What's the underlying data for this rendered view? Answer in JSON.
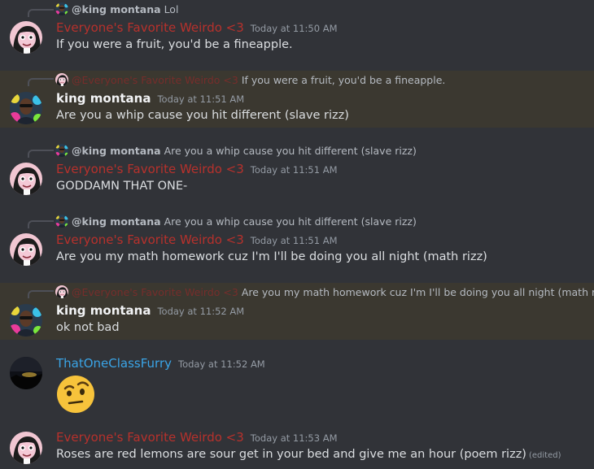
{
  "messages": [
    {
      "reply": {
        "author": "@king montana",
        "text": "Lol"
      },
      "author": "Everyone's Favorite Weirdo <3",
      "time": "Today at 11:50 AM",
      "content": "If you were a fruit, you'd be a fineapple."
    },
    {
      "reply": {
        "author": "@Everyone's Favorite Weirdo <3",
        "text": "If you were a fruit, you'd be a fineapple."
      },
      "author": "king montana",
      "time": "Today at 11:51 AM",
      "content": "Are you a whip cause you hit different (slave rizz)"
    },
    {
      "reply": {
        "author": "@king montana",
        "text": "Are you a whip cause you hit different (slave rizz)"
      },
      "author": "Everyone's Favorite Weirdo <3",
      "time": "Today at 11:51 AM",
      "content": "GODDAMN THAT ONE-"
    },
    {
      "reply": {
        "author": "@king montana",
        "text": "Are you a whip cause you hit different (slave rizz)"
      },
      "author": "Everyone's Favorite Weirdo <3",
      "time": "Today at 11:51 AM",
      "content": "Are you my math homework cuz I'm I'll be doing you all night (math rizz)"
    },
    {
      "reply": {
        "author": "@Everyone's Favorite Weirdo <3",
        "text": "Are you my math homework cuz I'm I'll be doing you all night (math rizz)"
      },
      "author": "king montana",
      "time": "Today at 11:52 AM",
      "content": "ok not bad"
    },
    {
      "author": "ThatOneClassFurry",
      "time": "Today at 11:52 AM",
      "emoji": "face-with-raised-eyebrow"
    },
    {
      "author": "Everyone's Favorite Weirdo <3",
      "time": "Today at 11:53 AM",
      "content": "Roses are red lemons are sour get in your bed and give me an hour (poem rizz)",
      "edited": "(edited)"
    }
  ],
  "colors": {
    "background": "#313338",
    "highlight": "#3b3830",
    "weirdo_name": "#b7312c",
    "furry_name": "#3aa4e6"
  }
}
